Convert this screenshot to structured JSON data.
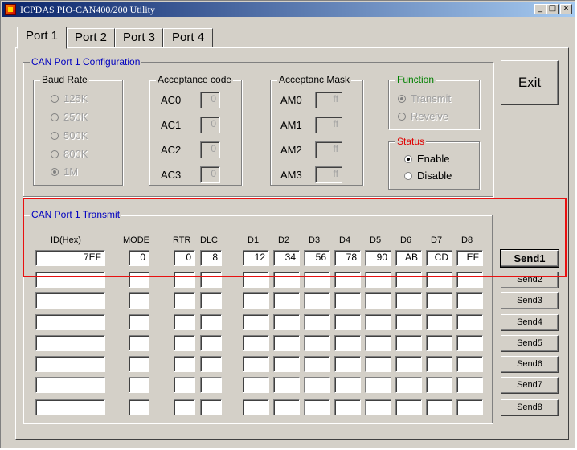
{
  "window": {
    "title": "ICPDAS PIO-CAN400/200 Utility",
    "min": "_",
    "max": "□",
    "close": "×"
  },
  "tabs": [
    "Port 1",
    "Port 2",
    "Port 3",
    "Port 4"
  ],
  "config": {
    "title": "CAN Port 1 Configuration",
    "baud": {
      "title": "Baud Rate",
      "options": [
        "125K",
        "250K",
        "500K",
        "800K",
        "1M"
      ],
      "selected": "1M"
    },
    "acc_code": {
      "title": "Acceptance code",
      "labels": [
        "AC0",
        "AC1",
        "AC2",
        "AC3"
      ],
      "values": [
        "0",
        "0",
        "0",
        "0"
      ]
    },
    "acc_mask": {
      "title": "Acceptanc Mask",
      "labels": [
        "AM0",
        "AM1",
        "AM2",
        "AM3"
      ],
      "values": [
        "ff",
        "ff",
        "ff",
        "ff"
      ]
    },
    "function": {
      "title": "Function",
      "options": [
        "Transmit",
        "Reveive"
      ],
      "selected": "Transmit"
    },
    "status": {
      "title": "Status",
      "options": [
        "Enable",
        "Disable"
      ],
      "selected": "Enable"
    }
  },
  "exit_label": "Exit",
  "transmit": {
    "title": "CAN Port 1 Transmit",
    "headers": {
      "id": "ID(Hex)",
      "mode": "MODE",
      "rtr": "RTR",
      "dlc": "DLC",
      "d": [
        "D1",
        "D2",
        "D3",
        "D4",
        "D5",
        "D6",
        "D7",
        "D8"
      ]
    },
    "rows": [
      {
        "id": "7EF",
        "mode": "0",
        "rtr": "0",
        "dlc": "8",
        "d": [
          "12",
          "34",
          "56",
          "78",
          "90",
          "AB",
          "CD",
          "EF"
        ],
        "send": "Send1"
      },
      {
        "id": "",
        "mode": "",
        "rtr": "",
        "dlc": "",
        "d": [
          "",
          "",
          "",
          "",
          "",
          "",
          "",
          ""
        ],
        "send": "Send2"
      },
      {
        "id": "",
        "mode": "",
        "rtr": "",
        "dlc": "",
        "d": [
          "",
          "",
          "",
          "",
          "",
          "",
          "",
          ""
        ],
        "send": "Send3"
      },
      {
        "id": "",
        "mode": "",
        "rtr": "",
        "dlc": "",
        "d": [
          "",
          "",
          "",
          "",
          "",
          "",
          "",
          ""
        ],
        "send": "Send4"
      },
      {
        "id": "",
        "mode": "",
        "rtr": "",
        "dlc": "",
        "d": [
          "",
          "",
          "",
          "",
          "",
          "",
          "",
          ""
        ],
        "send": "Send5"
      },
      {
        "id": "",
        "mode": "",
        "rtr": "",
        "dlc": "",
        "d": [
          "",
          "",
          "",
          "",
          "",
          "",
          "",
          ""
        ],
        "send": "Send6"
      },
      {
        "id": "",
        "mode": "",
        "rtr": "",
        "dlc": "",
        "d": [
          "",
          "",
          "",
          "",
          "",
          "",
          "",
          ""
        ],
        "send": "Send7"
      },
      {
        "id": "",
        "mode": "",
        "rtr": "",
        "dlc": "",
        "d": [
          "",
          "",
          "",
          "",
          "",
          "",
          "",
          ""
        ],
        "send": "Send8"
      }
    ]
  },
  "colors": {
    "group_title": "#0000c0",
    "function_title": "#008000",
    "status_title": "#e00000",
    "highlight": "#e81010",
    "face": "#d4d0c8"
  }
}
